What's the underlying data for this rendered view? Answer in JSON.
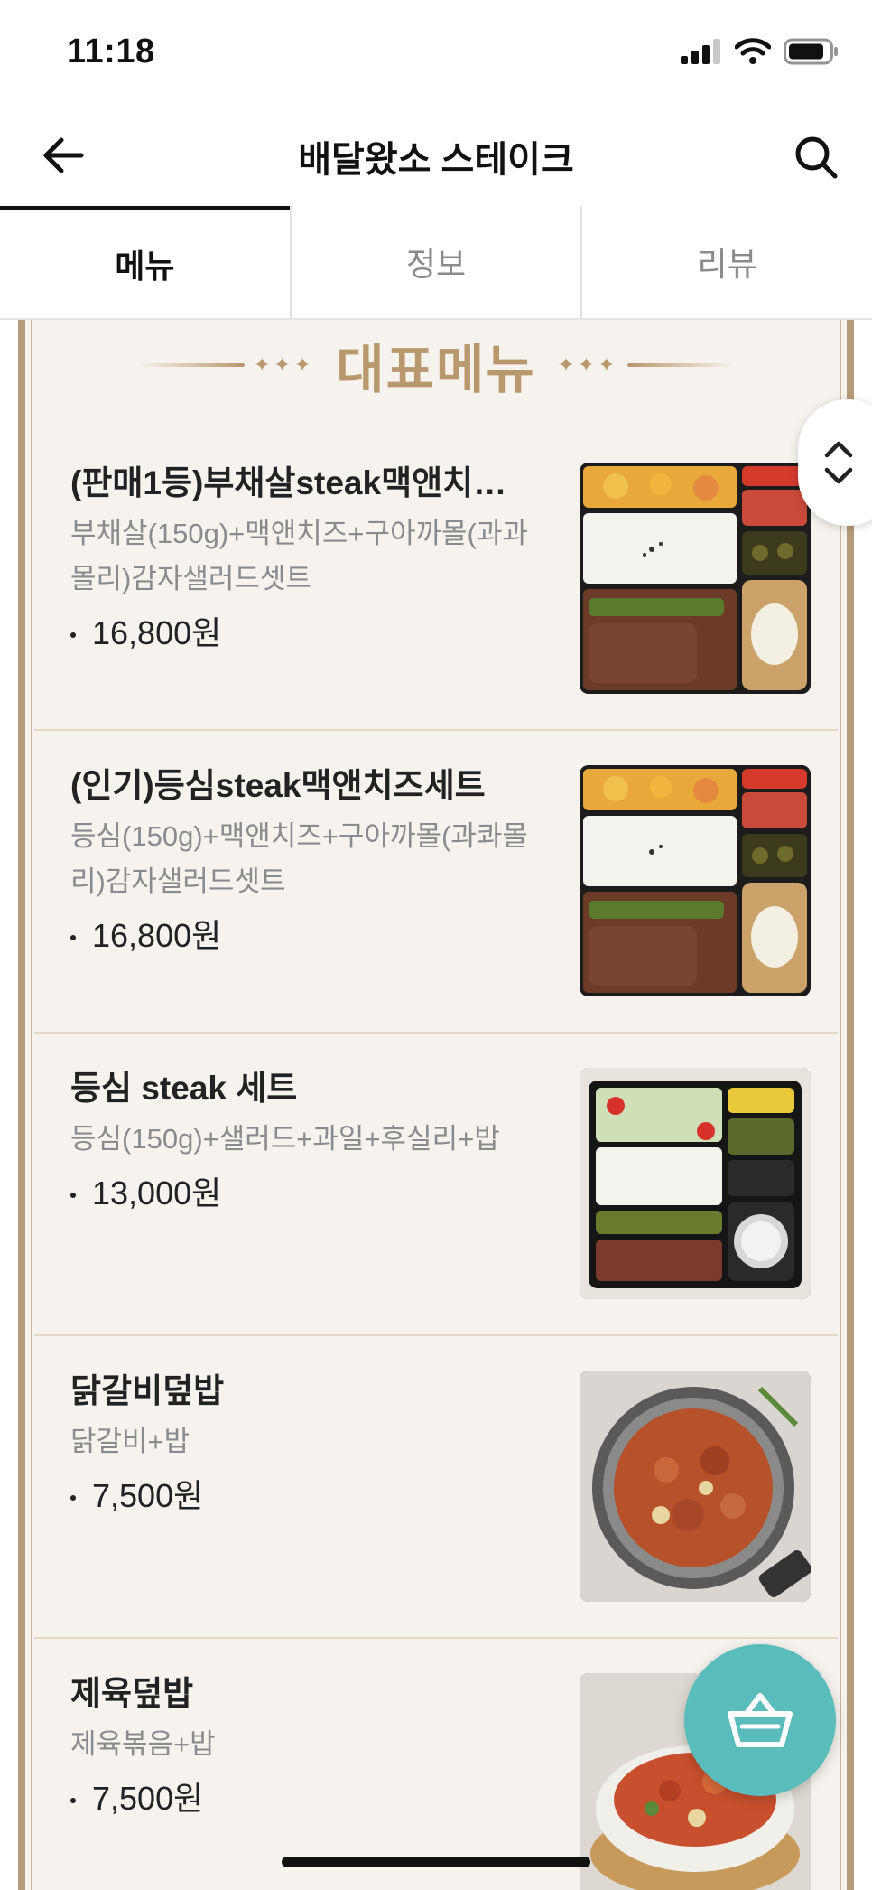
{
  "status_bar": {
    "time": "11:18"
  },
  "header": {
    "title": "배달왔소 스테이크"
  },
  "tabs": [
    {
      "label": "메뉴",
      "active": true
    },
    {
      "label": "정보",
      "active": false
    },
    {
      "label": "리뷰",
      "active": false
    }
  ],
  "section": {
    "title": "대표메뉴"
  },
  "menu": [
    {
      "name": "(판매1등)부채살steak맥앤치…",
      "desc": "부채살(150g)+맥앤치즈+구아까몰(과과몰리)감자샐러드셋트",
      "price": "16,800원",
      "image": "lunchbox-steak"
    },
    {
      "name": "(인기)등심steak맥앤치즈세트",
      "desc": "등심(150g)+맥앤치즈+구아까몰(과콰몰리)감자샐러드셋트",
      "price": "16,800원",
      "image": "lunchbox-steak"
    },
    {
      "name": "등심 steak 세트",
      "desc": "등심(150g)+샐러드+과일+후실리+밥",
      "price": "13,000원",
      "image": "lunchbox-sirloin"
    },
    {
      "name": "닭갈비덮밥",
      "desc": "닭갈비+밥",
      "price": "7,500원",
      "image": "dakgalbi-pan"
    },
    {
      "name": "제육덮밥",
      "desc": "제육볶음+밥",
      "price": "7,500원",
      "image": "jeyuk-bowl"
    }
  ],
  "colors": {
    "accent": "#b8986c",
    "fab": "#5bbdbb",
    "board": "#f6f3ee"
  }
}
